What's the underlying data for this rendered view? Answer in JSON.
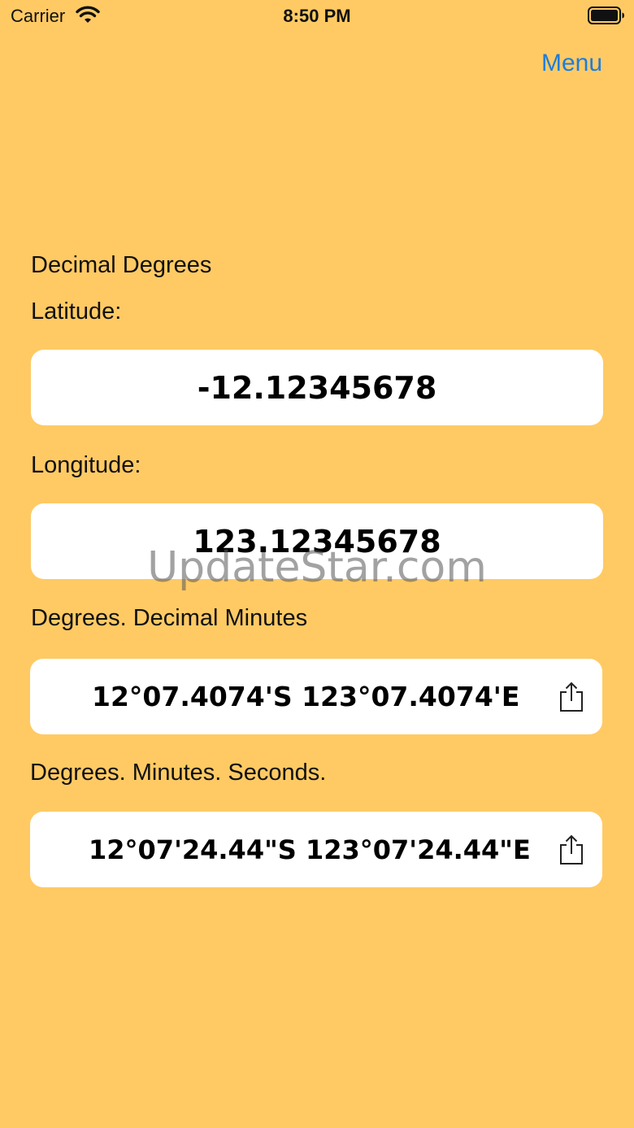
{
  "status_bar": {
    "carrier": "Carrier",
    "time": "8:50 PM"
  },
  "nav": {
    "menu_label": "Menu"
  },
  "decimal": {
    "section_label": "Decimal Degrees",
    "latitude_label": "Latitude:",
    "latitude_value": "-12.12345678",
    "longitude_label": "Longitude:",
    "longitude_value": "123.12345678"
  },
  "ddm": {
    "section_label": "Degrees. Decimal Minutes",
    "value": "12°07.4074'S 123°07.4074'E"
  },
  "dms": {
    "section_label": "Degrees. Minutes. Seconds.",
    "value": "12°07'24.44\"S 123°07'24.44\"E"
  },
  "watermark": "UpdateStar.com",
  "colors": {
    "background": "#FFCA64",
    "accent": "#1E7DDB",
    "field": "#FFFFFF"
  },
  "icons": [
    "wifi-icon",
    "battery-icon",
    "share-icon"
  ]
}
